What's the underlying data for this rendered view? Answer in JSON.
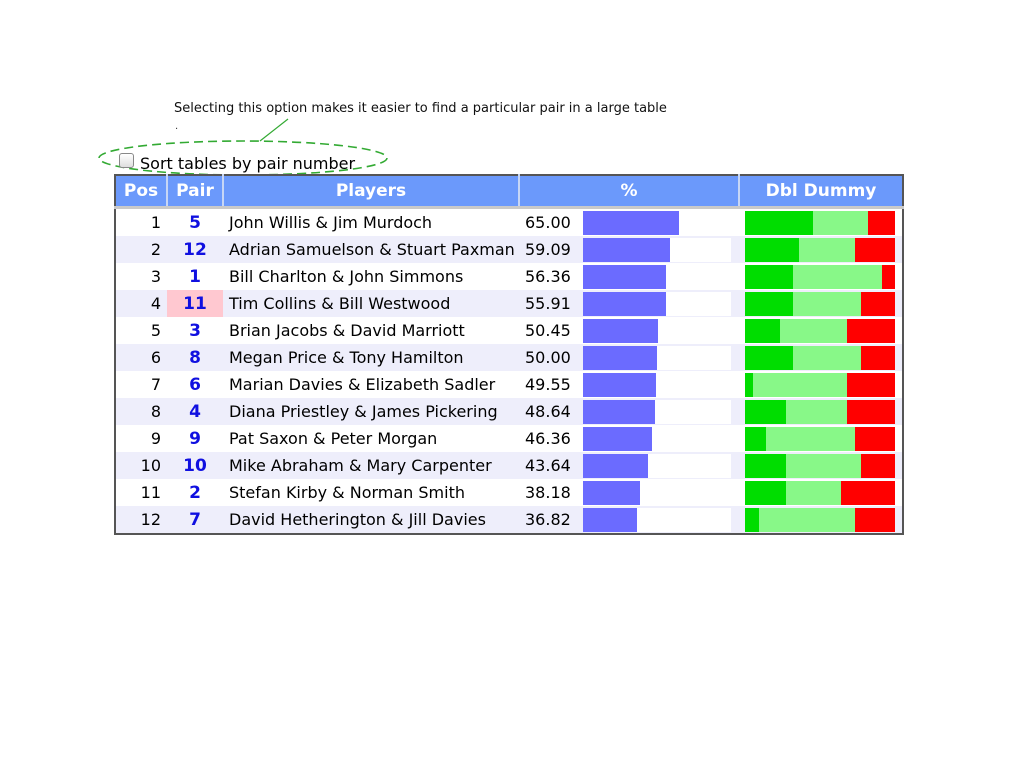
{
  "callout": {
    "text": "Selecting this option makes it easier to find a particular pair in a large table",
    "dot": "."
  },
  "sort_option": {
    "label": "Sort tables by pair number",
    "checked": false
  },
  "colors": {
    "header_bg": "#6b99fb",
    "pct_bar": "#6b6bff",
    "dd_made": "#00dd00",
    "dd_neutral": "#88f888",
    "dd_down": "#ff0000",
    "pair_text": "#1010e0",
    "highlight": "#ffc8d0",
    "callout_ellipse": "#33aa33"
  },
  "table": {
    "headers": {
      "pos": "Pos",
      "pair": "Pair",
      "players": "Players",
      "pct": "%",
      "dd": "Dbl Dummy"
    },
    "rows": [
      {
        "pos": "1",
        "pair": "5",
        "players": "John Willis & Jim Murdoch",
        "pct": "65.00",
        "dd": [
          0.45,
          0.37,
          0.18
        ]
      },
      {
        "pos": "2",
        "pair": "12",
        "players": "Adrian Samuelson & Stuart Paxman",
        "pct": "59.09",
        "dd": [
          0.36,
          0.37,
          0.27
        ]
      },
      {
        "pos": "3",
        "pair": "1",
        "players": "Bill Charlton & John Simmons",
        "pct": "56.36",
        "dd": [
          0.32,
          0.59,
          0.09
        ]
      },
      {
        "pos": "4",
        "pair": "11",
        "players": "Tim Collins & Bill Westwood",
        "pct": "55.91",
        "dd": [
          0.32,
          0.45,
          0.23
        ],
        "highlight": true
      },
      {
        "pos": "5",
        "pair": "3",
        "players": "Brian Jacobs & David Marriott",
        "pct": "50.45",
        "dd": [
          0.23,
          0.45,
          0.32
        ]
      },
      {
        "pos": "6",
        "pair": "8",
        "players": "Megan Price & Tony Hamilton",
        "pct": "50.00",
        "dd": [
          0.32,
          0.45,
          0.23
        ]
      },
      {
        "pos": "7",
        "pair": "6",
        "players": "Marian Davies & Elizabeth Sadler",
        "pct": "49.55",
        "dd": [
          0.05,
          0.63,
          0.32
        ]
      },
      {
        "pos": "8",
        "pair": "4",
        "players": "Diana Priestley & James Pickering",
        "pct": "48.64",
        "dd": [
          0.27,
          0.41,
          0.32
        ]
      },
      {
        "pos": "9",
        "pair": "9",
        "players": "Pat Saxon & Peter Morgan",
        "pct": "46.36",
        "dd": [
          0.14,
          0.59,
          0.27
        ]
      },
      {
        "pos": "10",
        "pair": "10",
        "players": "Mike Abraham & Mary Carpenter",
        "pct": "43.64",
        "dd": [
          0.27,
          0.5,
          0.23
        ]
      },
      {
        "pos": "11",
        "pair": "2",
        "players": "Stefan Kirby & Norman Smith",
        "pct": "38.18",
        "dd": [
          0.27,
          0.37,
          0.36
        ]
      },
      {
        "pos": "12",
        "pair": "7",
        "players": "David Hetherington & Jill Davies",
        "pct": "36.82",
        "dd": [
          0.09,
          0.64,
          0.27
        ]
      }
    ]
  }
}
